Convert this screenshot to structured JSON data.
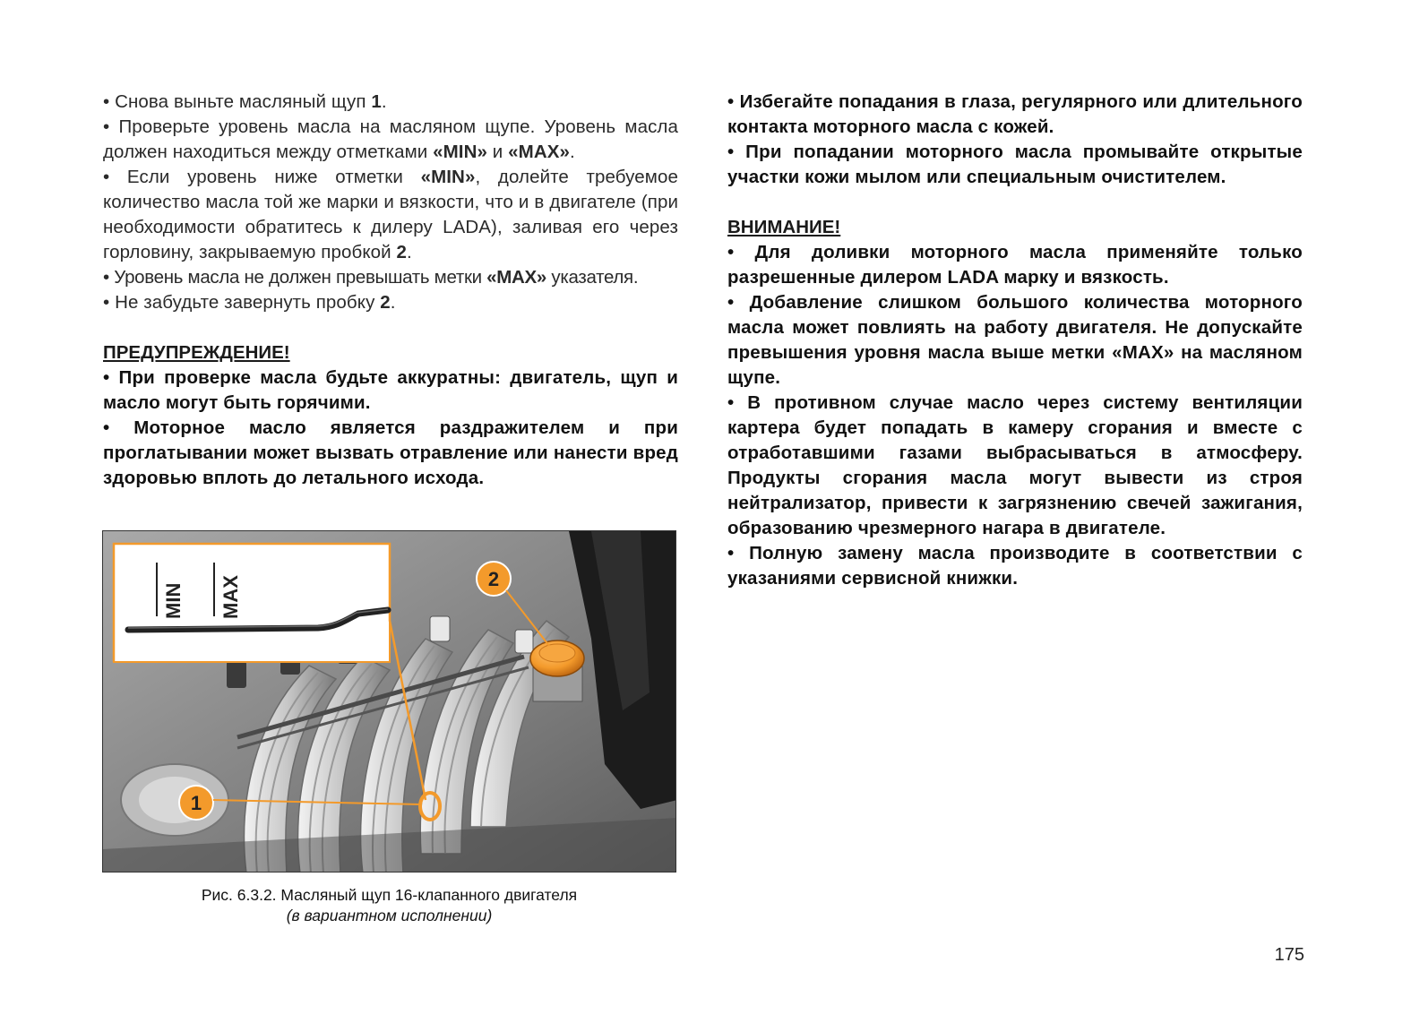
{
  "left": {
    "p1": "• Снова выньте масляный щуп ",
    "p1_num": "1",
    "p1_end": ".",
    "p2a": "• Проверьте уровень масла на масляном щупе. Уровень масла должен находиться между отметками ",
    "p2_min": "«MIN»",
    "p2_and": " и ",
    "p2_max": "«MAX»",
    "p2_end": ".",
    "p3a": "• Если уровень ниже отметки ",
    "p3_min": "«MIN»",
    "p3b": ", долейте требуемое количество масла той же марки и вязкости, что и в двигателе (при необходимости обратитесь к дилеру LADA), заливая его через горловину, закрываемую пробкой ",
    "p3_num": "2",
    "p3_end": ".",
    "p4a": "• Уровень масла не должен превышать метки ",
    "p4_max": "«MAX»",
    "p4b": " указателя.",
    "p5a": "• Не забудьте завернуть пробку ",
    "p5_num": "2",
    "p5_end": ".",
    "warning_heading": "ПРЕДУПРЕЖДЕНИЕ!",
    "w1": "• При проверке масла будьте аккуратны: двигатель, щуп и масло могут быть горячими.",
    "w2": "• Моторное масло является раздражителем и при проглатывании может вызвать отравление или нанести вред здоровью вплоть до летального исхода."
  },
  "right": {
    "r1": "• Избегайте попадания в глаза, регулярного или длительного контакта моторного масла с кожей.",
    "r2": "• При попадании моторного масла промывайте открытые участки кожи мылом или специальным очистителем.",
    "attention_heading": "ВНИМАНИЕ!",
    "a1": "• Для доливки моторного масла применяйте только разрешенные дилером LADA марку и вязкость.",
    "a2": "• Добавление слишком большого количества моторного масла может повлиять на работу двигателя. Не допускайте превышения уровня масла выше метки «MAX» на масляном щупе.",
    "a3": "• В противном случае масло через систему вентиляции картера будет попадать в камеру сгорания и вместе с отработавшими газами выбрасываться в атмосферу. Продукты сгорания масла могут вывести из строя нейтрализатор, привести к загрязнению свечей зажигания, образованию чрезмерного нагара в двигателе.",
    "a4": "• Полную замену масла производите в соответствии с указаниями сервисной книжки."
  },
  "figure": {
    "label_min": "MIN",
    "label_max": "MAX",
    "callout_1": "1",
    "callout_2": "2",
    "accent_color": "#f39a2b"
  },
  "caption": {
    "line1": "Рис. 6.3.2. Масляный щуп 16-клапанного двигателя",
    "line2": "(в вариантном исполнении)"
  },
  "page_number": "175"
}
